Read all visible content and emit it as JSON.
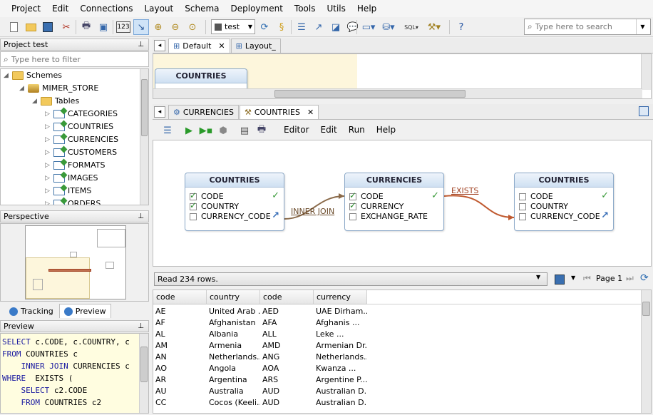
{
  "menu": [
    "Project",
    "Edit",
    "Connections",
    "Layout",
    "Schema",
    "Deployment",
    "Tools",
    "Utils",
    "Help"
  ],
  "toolbar": {
    "connection": "test",
    "search_placeholder": "Type here to search"
  },
  "project_panel": {
    "title": "Project test",
    "filter_placeholder": "Type here to filter",
    "tree": {
      "schemes": "Schemes",
      "schema": "MIMER_STORE",
      "tables": "Tables",
      "items": [
        "CATEGORIES",
        "COUNTRIES",
        "CURRENCIES",
        "CUSTOMERS",
        "FORMATS",
        "IMAGES",
        "ITEMS",
        "ORDERS"
      ]
    }
  },
  "perspective": {
    "title": "Perspective"
  },
  "bottom_tabs": {
    "tracking": "Tracking",
    "preview": "Preview"
  },
  "preview": {
    "title": "Preview",
    "sql_lines": [
      {
        "kw": "SELECT",
        "rest": " c.CODE, c.COUNTRY, c"
      },
      {
        "kw": "FROM",
        "rest": " COUNTRIES c"
      },
      {
        "kw": "    INNER JOIN",
        "rest": " CURRENCIES c"
      },
      {
        "kw": "WHERE",
        "rest": "  EXISTS ("
      },
      {
        "kw": "    SELECT",
        "rest": " c2.CODE"
      },
      {
        "kw": "    FROM",
        "rest": " COUNTRIES c2"
      }
    ]
  },
  "layout_tabs": [
    "Default",
    "Layout_"
  ],
  "layout_entity": "COUNTRIES",
  "query_tabs": [
    "CURRENCIES",
    "COUNTRIES"
  ],
  "query_menu": [
    "Editor",
    "Edit",
    "Run",
    "Help"
  ],
  "diagram": {
    "entities": [
      {
        "title": "COUNTRIES",
        "rows": [
          {
            "name": "CODE",
            "checked": true
          },
          {
            "name": "COUNTRY",
            "checked": true
          },
          {
            "name": "CURRENCY_CODE",
            "checked": false
          }
        ]
      },
      {
        "title": "CURRENCIES",
        "rows": [
          {
            "name": "CODE",
            "checked": true
          },
          {
            "name": "CURRENCY",
            "checked": true
          },
          {
            "name": "EXCHANGE_RATE",
            "checked": false
          }
        ]
      },
      {
        "title": "COUNTRIES",
        "rows": [
          {
            "name": "CODE",
            "checked": false
          },
          {
            "name": "COUNTRY",
            "checked": false
          },
          {
            "name": "CURRENCY_CODE",
            "checked": false
          }
        ]
      }
    ],
    "join1": "INNER JOIN",
    "join2": "EXISTS"
  },
  "result": {
    "status": "Read 234 rows.",
    "page": "Page 1",
    "columns": [
      "code",
      "country",
      "code",
      "currency"
    ],
    "rows": [
      [
        "AE",
        "United Arab ...",
        "AED",
        "UAE Dirham..."
      ],
      [
        "AF",
        "Afghanistan",
        "AFA",
        "Afghanis      ..."
      ],
      [
        "AL",
        "Albania",
        "ALL",
        "Leke            ..."
      ],
      [
        "AM",
        "Armenia",
        "AMD",
        "Armenian Dr..."
      ],
      [
        "AN",
        "Netherlands...",
        "ANG",
        "Netherlands..."
      ],
      [
        "AO",
        "Angola",
        "AOA",
        "Kwanza         ..."
      ],
      [
        "AR",
        "Argentina",
        "ARS",
        "Argentine P..."
      ],
      [
        "AU",
        "Australia",
        "AUD",
        "Australian D..."
      ],
      [
        "CC",
        "Cocos (Keeli...",
        "AUD",
        "Australian D..."
      ]
    ]
  }
}
